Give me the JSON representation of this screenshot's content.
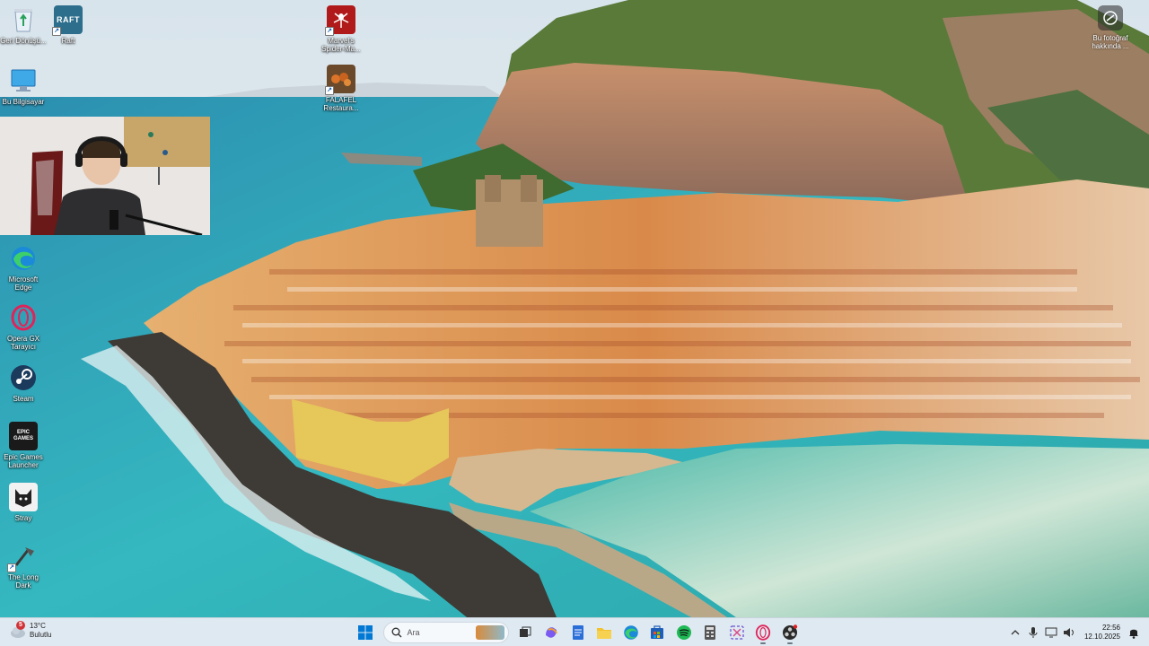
{
  "desktop": {
    "icons": [
      {
        "id": "recycle",
        "label": "Geri Dönüşü..."
      },
      {
        "id": "raft",
        "label": "Raft"
      },
      {
        "id": "spiderman",
        "label": "Marvel's Spider-Ma..."
      },
      {
        "id": "computer",
        "label": "Bu Bilgisayar"
      },
      {
        "id": "falafel",
        "label": "FALAFEL Restaura..."
      },
      {
        "id": "edge",
        "label": "Microsoft Edge"
      },
      {
        "id": "opera",
        "label": "Opera GX Tarayıcı"
      },
      {
        "id": "steam",
        "label": "Steam"
      },
      {
        "id": "epic",
        "label": "Epic Games Launcher"
      },
      {
        "id": "stray",
        "label": "Stray"
      },
      {
        "id": "longdark",
        "label": "The Long Dark"
      }
    ],
    "raft_logo": "RAFT",
    "epic_logo": "EPIC GAMES",
    "about_label": "Bu fotoğraf hakkında ..."
  },
  "taskbar": {
    "weather": {
      "temp": "13°C",
      "condition": "Bulutlu",
      "badge": "5"
    },
    "search_placeholder": "Ara",
    "apps": [
      "start",
      "search",
      "task-view",
      "copilot",
      "notepad",
      "file-explorer",
      "edge",
      "store",
      "spotify",
      "calculator",
      "snipping-tool",
      "opera-gx",
      "obs"
    ],
    "clock": {
      "time": "22:56",
      "date": "12.10.2025"
    }
  },
  "colors": {
    "accent": "#0078d4",
    "taskbar_bg": "#dfe9f1",
    "sea": "#2fb3c0",
    "cliff": "#b5826a"
  }
}
